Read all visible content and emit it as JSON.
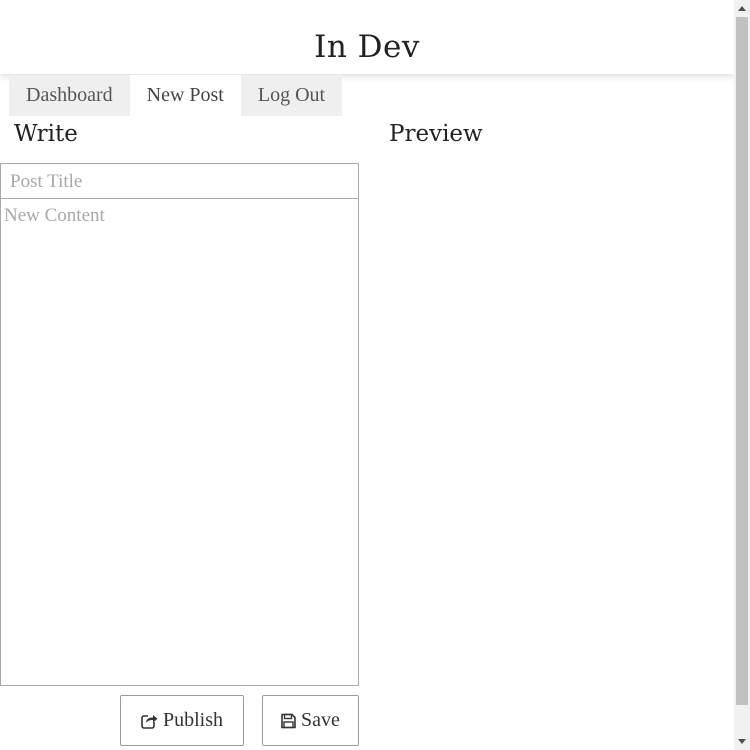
{
  "header": {
    "site_title": "In Dev"
  },
  "nav": {
    "tabs": [
      {
        "label": "Dashboard",
        "active": false
      },
      {
        "label": "New Post",
        "active": true
      },
      {
        "label": "Log Out",
        "active": false
      }
    ]
  },
  "editor": {
    "heading": "Write",
    "title_field": {
      "value": "",
      "placeholder": "Post Title"
    },
    "content_field": {
      "value": "",
      "placeholder": "New Content"
    },
    "publish_label": "Publish",
    "publish_icon": "share-icon",
    "save_label": "Save",
    "save_icon": "floppy-disk-icon"
  },
  "preview": {
    "heading": "Preview"
  }
}
